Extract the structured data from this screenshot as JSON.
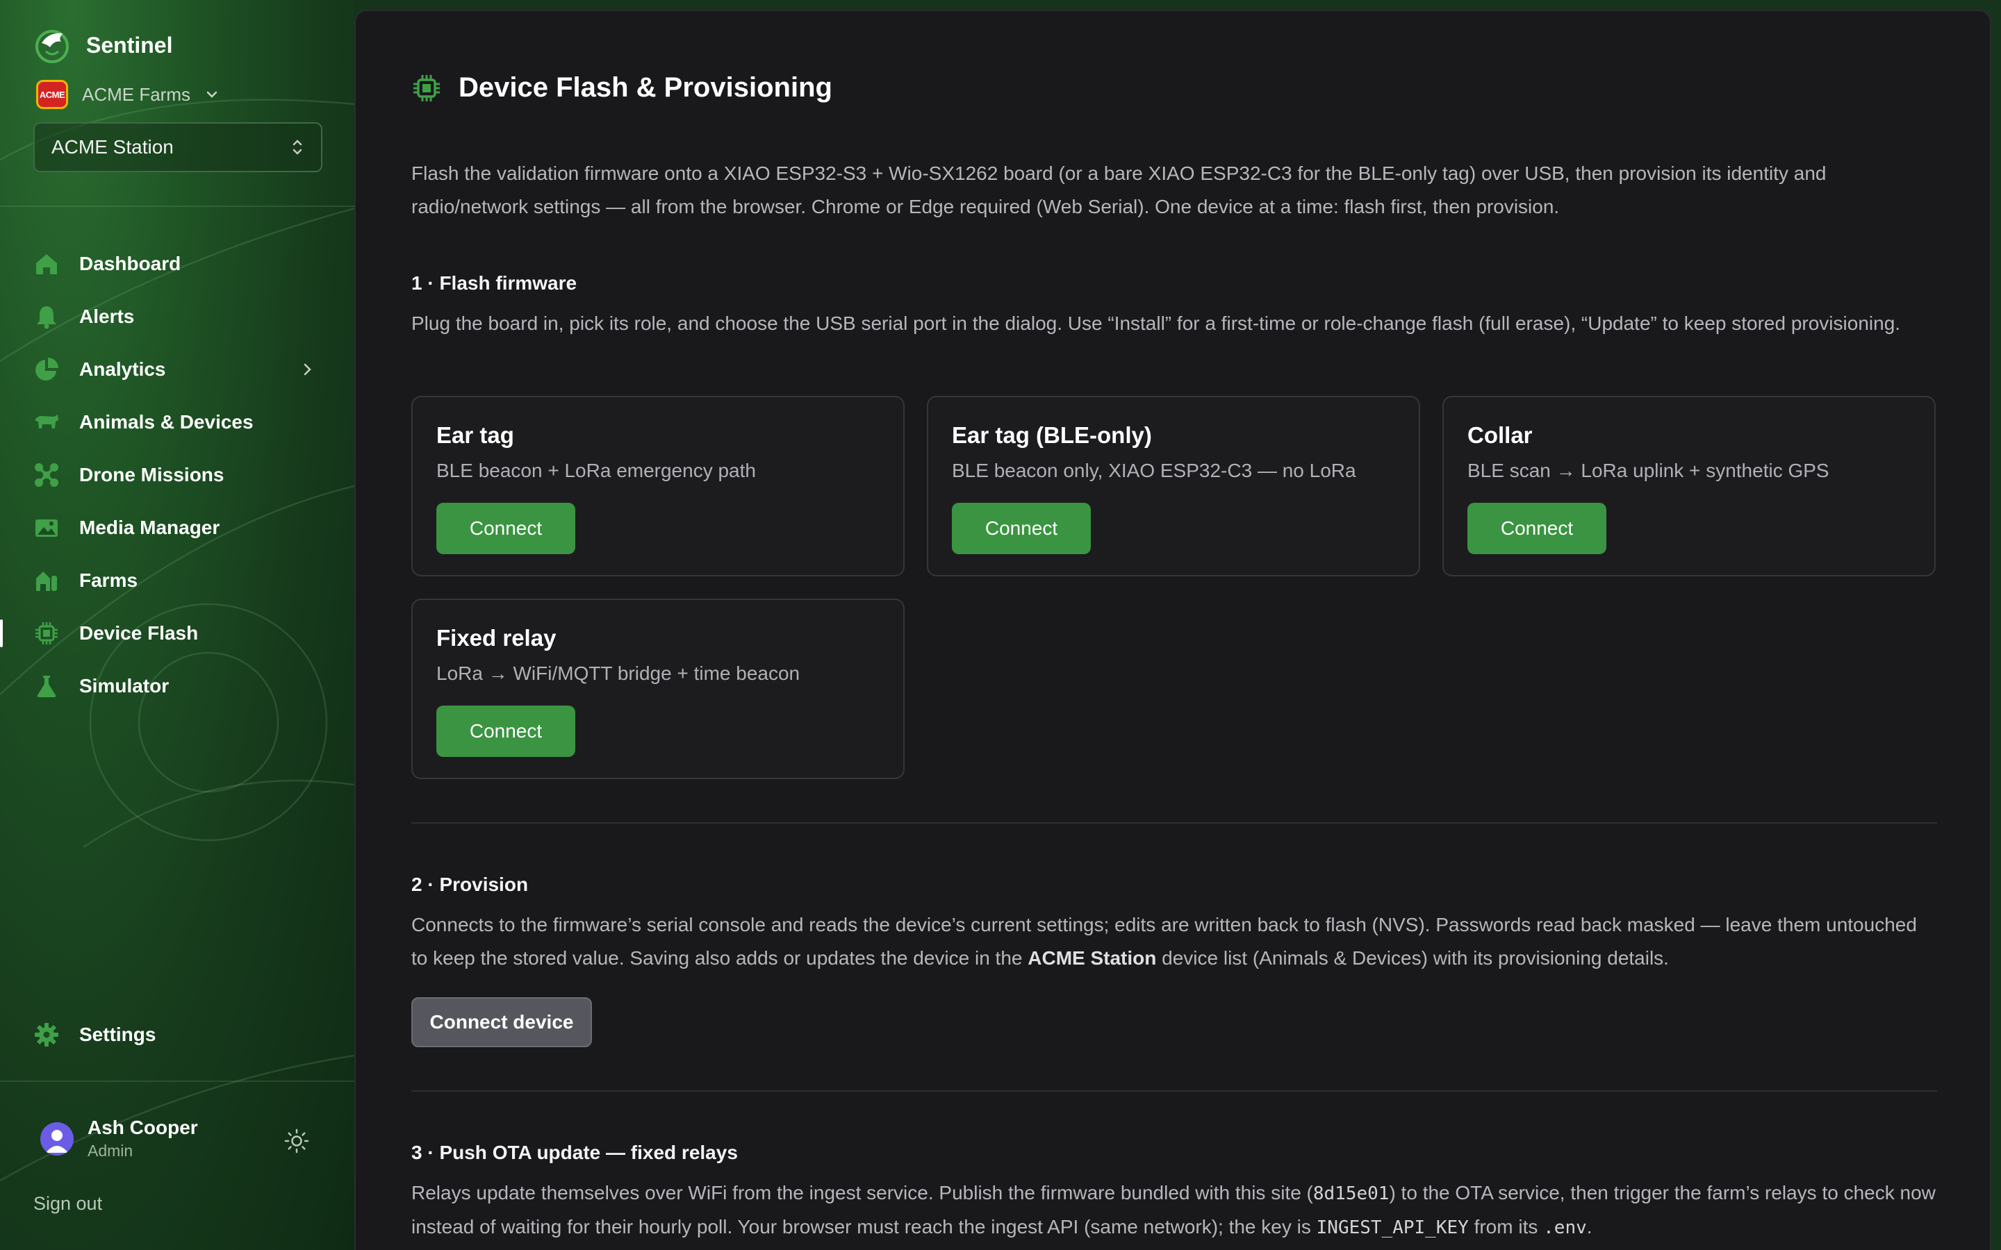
{
  "brand": {
    "name": "Sentinel"
  },
  "org": {
    "name": "ACME Farms",
    "logo_text": "ACME"
  },
  "station": {
    "selected": "ACME Station"
  },
  "nav": {
    "items": [
      {
        "label": "Dashboard",
        "icon": "home-icon"
      },
      {
        "label": "Alerts",
        "icon": "bell-icon"
      },
      {
        "label": "Analytics",
        "icon": "pie-chart-icon",
        "has_submenu": true
      },
      {
        "label": "Animals & Devices",
        "icon": "cow-icon"
      },
      {
        "label": "Drone Missions",
        "icon": "drone-icon"
      },
      {
        "label": "Media Manager",
        "icon": "image-icon"
      },
      {
        "label": "Farms",
        "icon": "barn-icon"
      },
      {
        "label": "Device Flash",
        "icon": "chip-icon",
        "active": true
      },
      {
        "label": "Simulator",
        "icon": "flask-icon"
      }
    ],
    "settings": {
      "label": "Settings",
      "icon": "gear-icon"
    }
  },
  "user": {
    "name": "Ash Cooper",
    "role": "Admin"
  },
  "signout": "Sign out",
  "page": {
    "title": "Device Flash & Provisioning",
    "intro": "Flash the validation firmware onto a XIAO ESP32-S3 + Wio-SX1262 board (or a bare XIAO ESP32-C3 for the BLE-only tag) over USB, then provision its identity and radio/network settings — all from the browser. Chrome or Edge required (Web Serial). One device at a time: flash first, then provision."
  },
  "flash": {
    "heading": "1 · Flash firmware",
    "desc": "Plug the board in, pick its role, and choose the USB serial port in the dialog. Use “Install” for a first-time or role-change flash (full erase), “Update” to keep stored provisioning.",
    "cards": [
      {
        "title": "Ear tag",
        "desc": "BLE beacon + LoRa emergency path",
        "button": "Connect"
      },
      {
        "title": "Ear tag (BLE-only)",
        "desc": "BLE beacon only, XIAO ESP32-C3 — no LoRa",
        "button": "Connect"
      },
      {
        "title": "Collar",
        "desc": "BLE scan → LoRa uplink + synthetic GPS",
        "button": "Connect"
      },
      {
        "title": "Fixed relay",
        "desc": "LoRa → WiFi/MQTT bridge + time beacon",
        "button": "Connect"
      }
    ]
  },
  "provision": {
    "heading": "2 · Provision",
    "desc_part1": "Connects to the firmware’s serial console and reads the device’s current settings; edits are written back to flash (NVS). Passwords read back masked — leave them untouched to keep the stored value. Saving also adds or updates the device in the ",
    "desc_station": "ACME Station",
    "desc_part2": " device list (Animals & Devices) with its provisioning details.",
    "button": "Connect device"
  },
  "ota": {
    "heading": "3 · Push OTA update — fixed relays",
    "desc_part1": "Relays update themselves over WiFi from the ingest service. Publish the firmware bundled with this site (",
    "commit": "8d15e01",
    "desc_part2": ") to the OTA service, then trigger the farm’s relays to check now instead of waiting for their hourly poll. Your browser must reach the ingest API (same network); the key is ",
    "key": "INGEST_API_KEY",
    "desc_part3": " from its ",
    "file": ".env",
    "desc_part4": "."
  },
  "colors": {
    "accent_green": "#3a9441",
    "sidebar_green": "#1f5425",
    "main_bg": "#19191c"
  }
}
